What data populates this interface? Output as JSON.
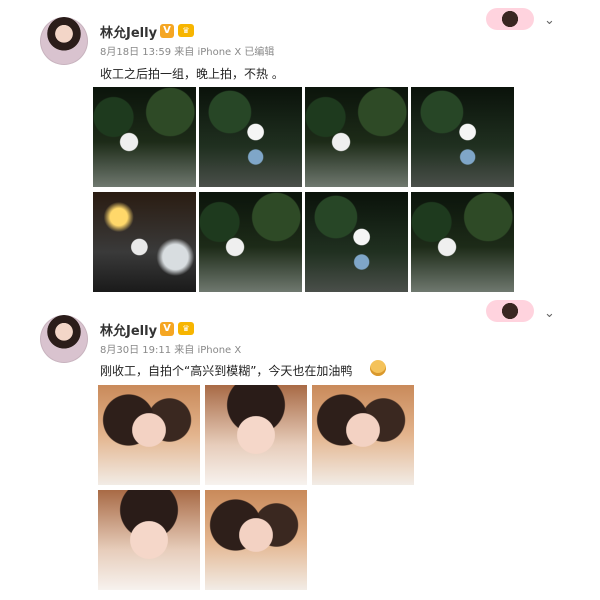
{
  "posts": [
    {
      "username": "林允Jelly",
      "verified": "V",
      "meta": "8月18日 13:59 来自 iPhone X   已编辑",
      "text": "收工之后拍一组，晚上拍，不热 。",
      "photo_count": 8
    },
    {
      "username": "林允Jelly",
      "verified": "V",
      "meta": "8月30日 19:11 来自 iPhone X",
      "text": "刚收工，自拍个“高兴到模糊”，今天也在加油鸭",
      "photo_count": 5
    }
  ],
  "icons": {
    "chevron": "chevron-down-icon",
    "emoji": "fist-emoji-icon"
  },
  "colors": {
    "badge": "#f5a623",
    "crown": "#f7b500",
    "meta": "#888888",
    "background": "#ffffff"
  }
}
